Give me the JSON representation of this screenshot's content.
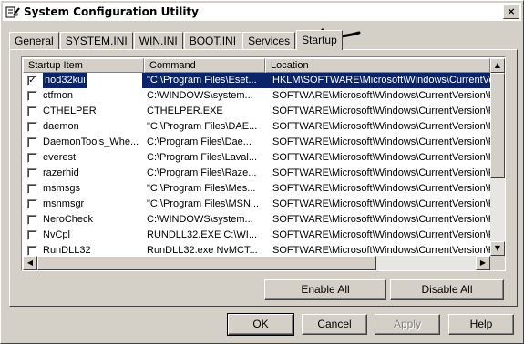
{
  "window": {
    "title": "System Configuration Utility",
    "close_glyph": "×"
  },
  "tabs": [
    "General",
    "SYSTEM.INI",
    "WIN.INI",
    "BOOT.INI",
    "Services",
    "Startup"
  ],
  "active_tab": "Startup",
  "columns": [
    "Startup Item",
    "Command",
    "Location"
  ],
  "rows": [
    {
      "item": "nod32kui",
      "command": "\"C:\\Program Files\\Eset...",
      "location": "HKLM\\SOFTWARE\\Microsoft\\Windows\\CurrentVer...",
      "checked": true,
      "selected": true
    },
    {
      "item": "ctfmon",
      "command": "C:\\WINDOWS\\system...",
      "location": "SOFTWARE\\Microsoft\\Windows\\CurrentVersion\\Ru",
      "checked": false,
      "selected": false
    },
    {
      "item": "CTHELPER",
      "command": "CTHELPER.EXE",
      "location": "SOFTWARE\\Microsoft\\Windows\\CurrentVersion\\Ru",
      "checked": false,
      "selected": false
    },
    {
      "item": "daemon",
      "command": "\"C:\\Program Files\\DAE...",
      "location": "SOFTWARE\\Microsoft\\Windows\\CurrentVersion\\Ru",
      "checked": false,
      "selected": false
    },
    {
      "item": "DaemonTools_Whe...",
      "command": "C:\\Program Files\\Dae...",
      "location": "SOFTWARE\\Microsoft\\Windows\\CurrentVersion\\Ru",
      "checked": false,
      "selected": false
    },
    {
      "item": "everest",
      "command": "C:\\Program Files\\Laval...",
      "location": "SOFTWARE\\Microsoft\\Windows\\CurrentVersion\\Ru",
      "checked": false,
      "selected": false
    },
    {
      "item": "razerhid",
      "command": "C:\\Program Files\\Raze...",
      "location": "SOFTWARE\\Microsoft\\Windows\\CurrentVersion\\Ru",
      "checked": false,
      "selected": false
    },
    {
      "item": "msmsgs",
      "command": "\"C:\\Program Files\\Mes...",
      "location": "SOFTWARE\\Microsoft\\Windows\\CurrentVersion\\Ru",
      "checked": false,
      "selected": false
    },
    {
      "item": "msnmsgr",
      "command": "\"C:\\Program Files\\MSN...",
      "location": "SOFTWARE\\Microsoft\\Windows\\CurrentVersion\\Ru",
      "checked": false,
      "selected": false
    },
    {
      "item": "NeroCheck",
      "command": "C:\\WINDOWS\\system...",
      "location": "SOFTWARE\\Microsoft\\Windows\\CurrentVersion\\Ru",
      "checked": false,
      "selected": false
    },
    {
      "item": "NvCpl",
      "command": "RUNDLL32.EXE C:\\WI...",
      "location": "SOFTWARE\\Microsoft\\Windows\\CurrentVersion\\Ru",
      "checked": false,
      "selected": false
    },
    {
      "item": "RunDLL32",
      "command": "RunDLL32.exe NvMCT...",
      "location": "SOFTWARE\\Microsoft\\Windows\\CurrentVersion\\Ru",
      "checked": false,
      "selected": false
    }
  ],
  "buttons": {
    "enable_all": "Enable All",
    "disable_all": "Disable All",
    "ok": "OK",
    "cancel": "Cancel",
    "apply": "Apply",
    "help": "Help"
  },
  "icons": {
    "app": "msconfig-icon",
    "close": "close-icon",
    "check": "✓",
    "scroll_up": "▲",
    "scroll_down": "▼",
    "scroll_left": "◀",
    "scroll_right": "▶"
  },
  "colors": {
    "selection": "#0a246a",
    "face": "#d4d0c8"
  }
}
